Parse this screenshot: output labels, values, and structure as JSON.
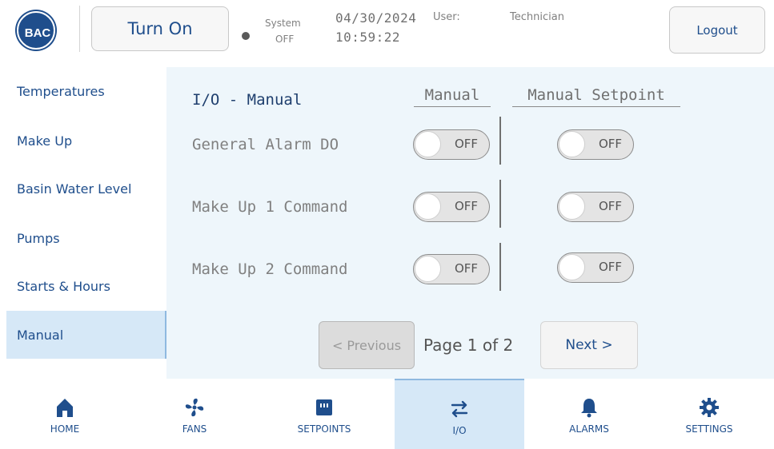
{
  "header": {
    "logo_text": "BAC",
    "turn_on_label": "Turn On",
    "system_label": "System",
    "system_status": "OFF",
    "date": "04/30/2024",
    "time": "10:59:22",
    "user_label": "User:",
    "user_value": "Technician",
    "logout_label": "Logout"
  },
  "sidebar": {
    "items": [
      {
        "label": "Temperatures"
      },
      {
        "label": "Make Up"
      },
      {
        "label": "Basin Water Level"
      },
      {
        "label": "Pumps"
      },
      {
        "label": "Starts & Hours"
      },
      {
        "label": "Manual"
      }
    ],
    "active": "Manual"
  },
  "main": {
    "title": "I/O - Manual",
    "col_manual": "Manual",
    "col_setpoint": "Manual Setpoint",
    "rows": [
      {
        "label": "General Alarm DO",
        "manual": "OFF",
        "setpoint": "OFF"
      },
      {
        "label": "Make Up 1 Command",
        "manual": "OFF",
        "setpoint": "OFF"
      },
      {
        "label": "Make Up 2 Command",
        "manual": "OFF",
        "setpoint": "OFF"
      }
    ],
    "prev_label": "< Previous",
    "page_indicator": "Page 1 of 2",
    "next_label": "Next >"
  },
  "nav": {
    "items": [
      {
        "label": "HOME",
        "icon": "home-icon"
      },
      {
        "label": "FANS",
        "icon": "fan-icon"
      },
      {
        "label": "SETPOINTS",
        "icon": "setpoints-icon"
      },
      {
        "label": "I/O",
        "icon": "io-arrows-icon"
      },
      {
        "label": "ALARMS",
        "icon": "bell-icon"
      },
      {
        "label": "SETTINGS",
        "icon": "gear-icon"
      }
    ],
    "active": "I/O"
  },
  "colors": {
    "accent": "#1f4e8c",
    "active_bg": "#d6e8f7",
    "panel_bg": "#eef6fb"
  }
}
